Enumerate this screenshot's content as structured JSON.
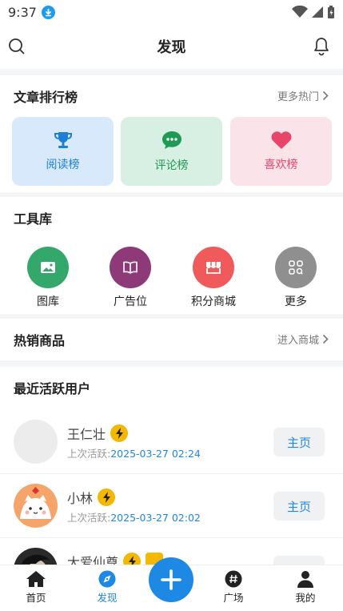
{
  "status_bar": {
    "time": "9:37"
  },
  "header": {
    "title": "发现"
  },
  "ranking": {
    "title": "文章排行榜",
    "more_label": "更多热门",
    "tiles": [
      {
        "label": "阅读榜",
        "icon": "trophy-icon",
        "bg": "#d7e9fb",
        "color": "#1e7fd6"
      },
      {
        "label": "评论榜",
        "icon": "comment-icon",
        "bg": "#d8efe3",
        "color": "#1f9a55"
      },
      {
        "label": "喜欢榜",
        "icon": "heart-icon",
        "bg": "#fbe3ea",
        "color": "#e8456b"
      }
    ]
  },
  "tools": {
    "title": "工具库",
    "items": [
      {
        "label": "图库",
        "icon": "image-icon",
        "color": "#34a86b"
      },
      {
        "label": "广告位",
        "icon": "book-icon",
        "color": "#8e3a78"
      },
      {
        "label": "积分商城",
        "icon": "store-icon",
        "color": "#f05a5a"
      },
      {
        "label": "更多",
        "icon": "grid-icon",
        "color": "#8f8f8f"
      }
    ]
  },
  "hot_products": {
    "title": "热销商品",
    "link_label": "进入商城"
  },
  "active_users": {
    "title": "最近活跃用户",
    "last_active_label": "上次活跃:",
    "home_label": "主页",
    "users": [
      {
        "name": "王仁壮",
        "last_active": "2025-03-27 02:24"
      },
      {
        "name": "小林",
        "last_active": "2025-03-27 02:02"
      },
      {
        "name": "大爱仙尊",
        "last_active": ""
      }
    ]
  },
  "tabbar": {
    "items": [
      {
        "label": "首页",
        "icon": "home-icon"
      },
      {
        "label": "发现",
        "icon": "compass-icon",
        "active": true
      },
      {
        "label": "广场",
        "icon": "hashtag-icon"
      },
      {
        "label": "我的",
        "icon": "user-icon"
      }
    ],
    "add_icon": "plus-icon"
  }
}
